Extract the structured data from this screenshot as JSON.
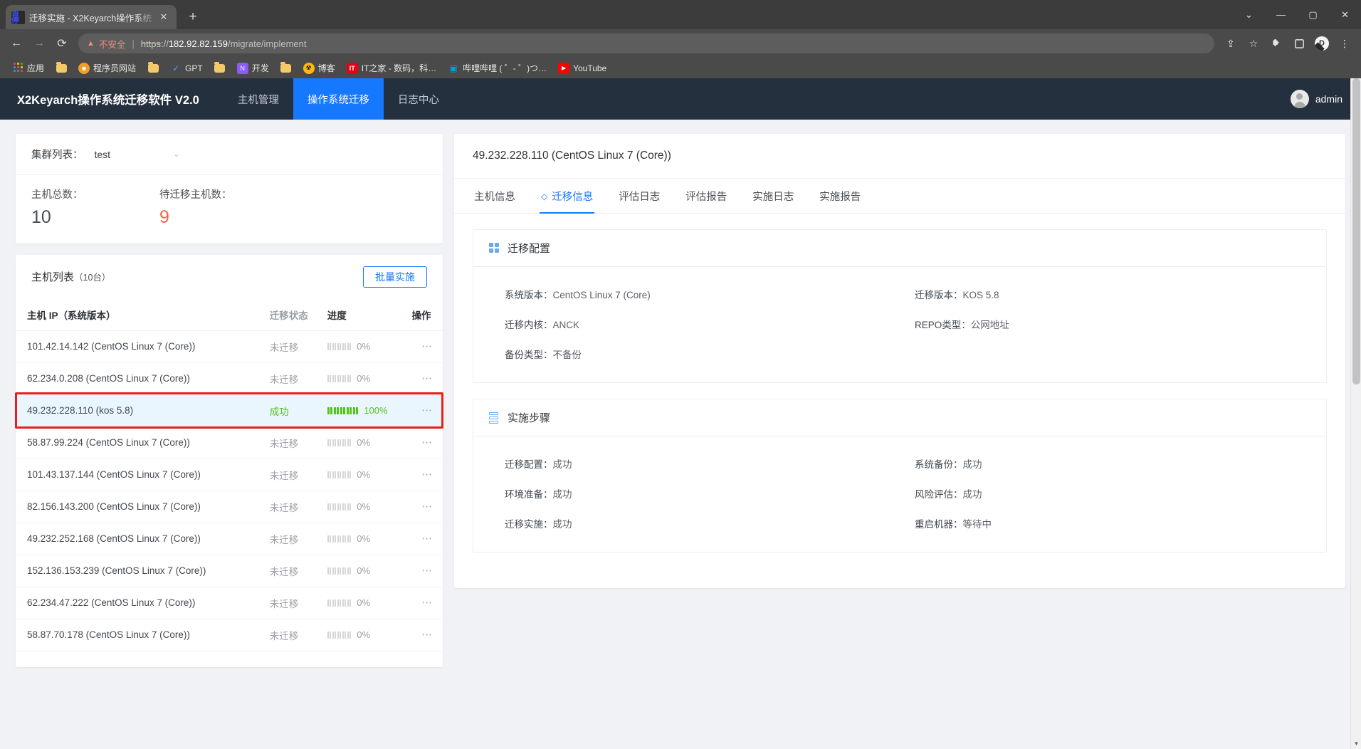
{
  "browser": {
    "tab": {
      "favicon_text": "暂停",
      "title": "迁移实施 - X2Keyarch操作系统",
      "close_label": "✕"
    },
    "newtab_label": "+",
    "window_controls": [
      {
        "name": "minimize-to-tray",
        "label": "⌄"
      },
      {
        "name": "minimize",
        "label": "—"
      },
      {
        "name": "maximize",
        "label": "▢"
      },
      {
        "name": "close",
        "label": "✕"
      }
    ],
    "nav": {
      "back": "←",
      "forward": "→",
      "reload": "⟳"
    },
    "omnibox": {
      "warning_icon": "▲",
      "security_text": "不安全",
      "scheme": "https",
      "separator": "://",
      "host": "182.92.82.159",
      "path": "/migrate/implement"
    },
    "toolbar_icons": [
      {
        "name": "share-icon",
        "glyph": "⇪"
      },
      {
        "name": "bookmark-star-icon",
        "glyph": "☆"
      },
      {
        "name": "extensions-puzzle-icon",
        "glyph": "🧩"
      },
      {
        "name": "side-panel-icon",
        "glyph": "▢"
      },
      {
        "name": "profile-avatar",
        "glyph": "D"
      },
      {
        "name": "chrome-menu-icon",
        "glyph": "⋮"
      }
    ],
    "bookmarks": [
      {
        "icon": "apps-grid-icon",
        "label": "应用"
      },
      {
        "icon": "folder-icon",
        "label": ""
      },
      {
        "icon": "site-icon",
        "label": "程序员网站"
      },
      {
        "icon": "folder-icon",
        "label": ""
      },
      {
        "icon": "gpt-icon",
        "label": "GPT"
      },
      {
        "icon": "folder-icon",
        "label": ""
      },
      {
        "icon": "dev-icon",
        "label": "开发"
      },
      {
        "icon": "folder-icon",
        "label": ""
      },
      {
        "icon": "blog-icon",
        "label": "博客"
      },
      {
        "icon": "ithome-icon",
        "label": "IT之家 - 数码，科…"
      },
      {
        "icon": "bilibili-icon",
        "label": "哔哩哔哩 ( ゜- ゜)つ…"
      },
      {
        "icon": "youtube-icon",
        "label": "YouTube"
      }
    ]
  },
  "app": {
    "brand": "X2Keyarch操作系统迁移软件 V2.0",
    "nav": [
      {
        "label": "主机管理",
        "active": false
      },
      {
        "label": "操作系统迁移",
        "active": true
      },
      {
        "label": "日志中心",
        "active": false
      }
    ],
    "user": "admin"
  },
  "left_panel": {
    "cluster_label": "集群列表：",
    "cluster_value": "test",
    "stats": [
      {
        "label": "主机总数：",
        "value": "10",
        "highlight": false
      },
      {
        "label": "待迁移主机数：",
        "value": "9",
        "highlight": true
      }
    ],
    "list_title": "主机列表",
    "list_count": "（10台）",
    "batch_button": "批量实施",
    "columns": [
      "主机 IP（系统版本）",
      "迁移状态",
      "进度",
      "操作"
    ],
    "rows": [
      {
        "ip": "101.42.14.142 (CentOS Linux 7 (Core))",
        "status": "未迁移",
        "progress": "0%",
        "pct": 0,
        "selected": false,
        "actions": "⋯"
      },
      {
        "ip": "62.234.0.208 (CentOS Linux 7 (Core))",
        "status": "未迁移",
        "progress": "0%",
        "pct": 0,
        "selected": false,
        "actions": "⋯"
      },
      {
        "ip": "49.232.228.110 (kos 5.8)",
        "status": "成功",
        "progress": "100%",
        "pct": 100,
        "selected": true,
        "actions": "⋯"
      },
      {
        "ip": "58.87.99.224 (CentOS Linux 7 (Core))",
        "status": "未迁移",
        "progress": "0%",
        "pct": 0,
        "selected": false,
        "actions": "⋯"
      },
      {
        "ip": "101.43.137.144 (CentOS Linux 7 (Core))",
        "status": "未迁移",
        "progress": "0%",
        "pct": 0,
        "selected": false,
        "actions": "⋯"
      },
      {
        "ip": "82.156.143.200 (CentOS Linux 7 (Core))",
        "status": "未迁移",
        "progress": "0%",
        "pct": 0,
        "selected": false,
        "actions": "⋯"
      },
      {
        "ip": "49.232.252.168 (CentOS Linux 7 (Core))",
        "status": "未迁移",
        "progress": "0%",
        "pct": 0,
        "selected": false,
        "actions": "⋯"
      },
      {
        "ip": "152.136.153.239 (CentOS Linux 7 (Core))",
        "status": "未迁移",
        "progress": "0%",
        "pct": 0,
        "selected": false,
        "actions": "⋯"
      },
      {
        "ip": "62.234.47.222 (CentOS Linux 7 (Core))",
        "status": "未迁移",
        "progress": "0%",
        "pct": 0,
        "selected": false,
        "actions": "⋯"
      },
      {
        "ip": "58.87.70.178 (CentOS Linux 7 (Core))",
        "status": "未迁移",
        "progress": "0%",
        "pct": 0,
        "selected": false,
        "actions": "⋯"
      }
    ]
  },
  "right_panel": {
    "title": "49.232.228.110 (CentOS Linux 7 (Core))",
    "tabs": [
      {
        "label": "主机信息",
        "active": false
      },
      {
        "label": "迁移信息",
        "active": true
      },
      {
        "label": "评估日志",
        "active": false
      },
      {
        "label": "评估报告",
        "active": false
      },
      {
        "label": "实施日志",
        "active": false
      },
      {
        "label": "实施报告",
        "active": false
      }
    ],
    "migrate_config": {
      "heading": "迁移配置",
      "items": [
        {
          "key": "系统版本：",
          "value": "CentOS Linux 7 (Core)"
        },
        {
          "key": "迁移版本：",
          "value": "KOS 5.8"
        },
        {
          "key": "迁移内核：",
          "value": "ANCK"
        },
        {
          "key": "REPO类型：",
          "value": "公网地址"
        },
        {
          "key": "备份类型：",
          "value": "不备份"
        },
        {
          "key": "",
          "value": ""
        }
      ]
    },
    "implement_steps": {
      "heading": "实施步骤",
      "items": [
        {
          "key": "迁移配置：",
          "value": "成功"
        },
        {
          "key": "系统备份：",
          "value": "成功"
        },
        {
          "key": "环境准备：",
          "value": "成功"
        },
        {
          "key": "风险评估：",
          "value": "成功"
        },
        {
          "key": "迁移实施：",
          "value": "成功"
        },
        {
          "key": "重启机器：",
          "value": "等待中"
        }
      ]
    }
  },
  "colors": {
    "accent": "#1677ff",
    "appbar": "#25303f",
    "success": "#52c41a",
    "warn": "#f5634a",
    "highlight_box": "#ee1c1c",
    "selected_row": "#eaf6fd"
  }
}
